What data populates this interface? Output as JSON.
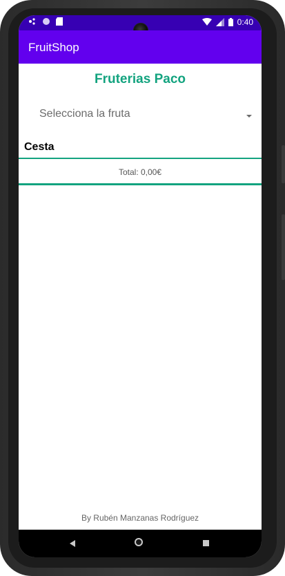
{
  "status_bar": {
    "time": "0:40",
    "left_icons": [
      "notification-dots-icon",
      "circle-icon",
      "sd-card-icon"
    ],
    "right_icons": [
      "wifi-icon",
      "signal-icon",
      "battery-icon"
    ]
  },
  "app_bar": {
    "title": "FruitShop"
  },
  "main": {
    "shop_title": "Fruterias Paco",
    "fruit_select": {
      "selected": "Selecciona la fruta"
    },
    "basket_label": "Cesta",
    "total_text": "Total: 0,00€",
    "footer": "By Rubén Manzanas Rodríguez"
  },
  "nav_bar": {
    "icons": [
      "back-icon",
      "home-icon",
      "recents-icon"
    ]
  },
  "colors": {
    "status_bar": "#3700b3",
    "app_bar": "#6200ee",
    "accent": "#13a37f"
  }
}
